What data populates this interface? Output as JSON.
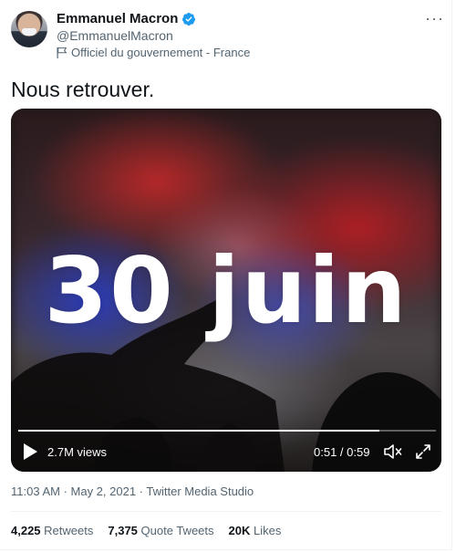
{
  "author": {
    "display_name": "Emmanuel Macron",
    "handle": "@EmmanuelMacron",
    "label": "Officiel du gouvernement - France"
  },
  "more_menu": "···",
  "tweet": {
    "text": "Nous retrouver.",
    "meta": "11:03 AM · May 2, 2021 · Twitter Media Studio"
  },
  "video": {
    "overlay_text": "30 juin",
    "views": "2.7M views",
    "time": "0:51 / 0:59",
    "progress": 0.864
  },
  "stats": {
    "retweets_count": "4,225",
    "retweets_label": "Retweets",
    "quotes_count": "7,375",
    "quotes_label": "Quote Tweets",
    "likes_count": "20K",
    "likes_label": "Likes"
  },
  "colors": {
    "verified": "#1d9bf0",
    "secondary_text": "#536471",
    "primary_text": "#0f1419"
  },
  "icons": [
    "verified-badge-icon",
    "flag-icon",
    "more-icon",
    "play-icon",
    "volume-icon",
    "fullscreen-icon"
  ]
}
